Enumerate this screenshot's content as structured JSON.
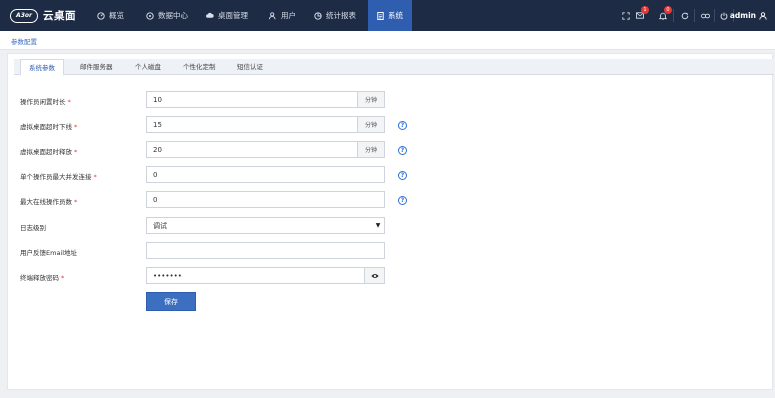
{
  "brand": {
    "logo_mark": "A3or",
    "name": "云桌面"
  },
  "nav": [
    {
      "label": "概览",
      "icon": "dashboard-icon"
    },
    {
      "label": "数据中心",
      "icon": "database-icon"
    },
    {
      "label": "桌面管理",
      "icon": "cloud-icon"
    },
    {
      "label": "用户",
      "icon": "users-icon"
    },
    {
      "label": "统计报表",
      "icon": "chart-icon"
    },
    {
      "label": "系统",
      "icon": "document-icon",
      "active": true
    }
  ],
  "tools": {
    "messages_badge": "1",
    "alerts_badge": "0",
    "user_name": "admin"
  },
  "breadcrumb": "参数配置",
  "tabs": [
    {
      "label": "系统参数",
      "active": true
    },
    {
      "label": "邮件服务器"
    },
    {
      "label": "个人磁盘"
    },
    {
      "label": "个性化定制"
    },
    {
      "label": "短信认证"
    }
  ],
  "form": {
    "idle_timeout": {
      "label": "操作员闲置时长",
      "required": "*",
      "value": "10",
      "unit": "分钟"
    },
    "desktop_offline_timeout": {
      "label": "虚拟桌面超时下线",
      "required": "*",
      "value": "15",
      "unit": "分钟"
    },
    "desktop_release_timeout": {
      "label": "虚拟桌面超时释放",
      "required": "*",
      "value": "20",
      "unit": "分钟"
    },
    "max_concurrent": {
      "label": "单个操作员最大并发连接",
      "required": "*",
      "value": "0"
    },
    "max_online": {
      "label": "最大在线操作员数",
      "required": "*",
      "value": "0"
    },
    "log_level": {
      "label": "日志级别",
      "value": "调试"
    },
    "feedback_email": {
      "label": "用户反馈Email地址",
      "value": ""
    },
    "terminal_release_password": {
      "label": "终端释放密码",
      "required": "*",
      "value": "•••••••"
    },
    "save_label": "保存"
  },
  "colors": {
    "topbar": "#1d2b45",
    "accent": "#2f5db0",
    "required": "#e53935"
  }
}
